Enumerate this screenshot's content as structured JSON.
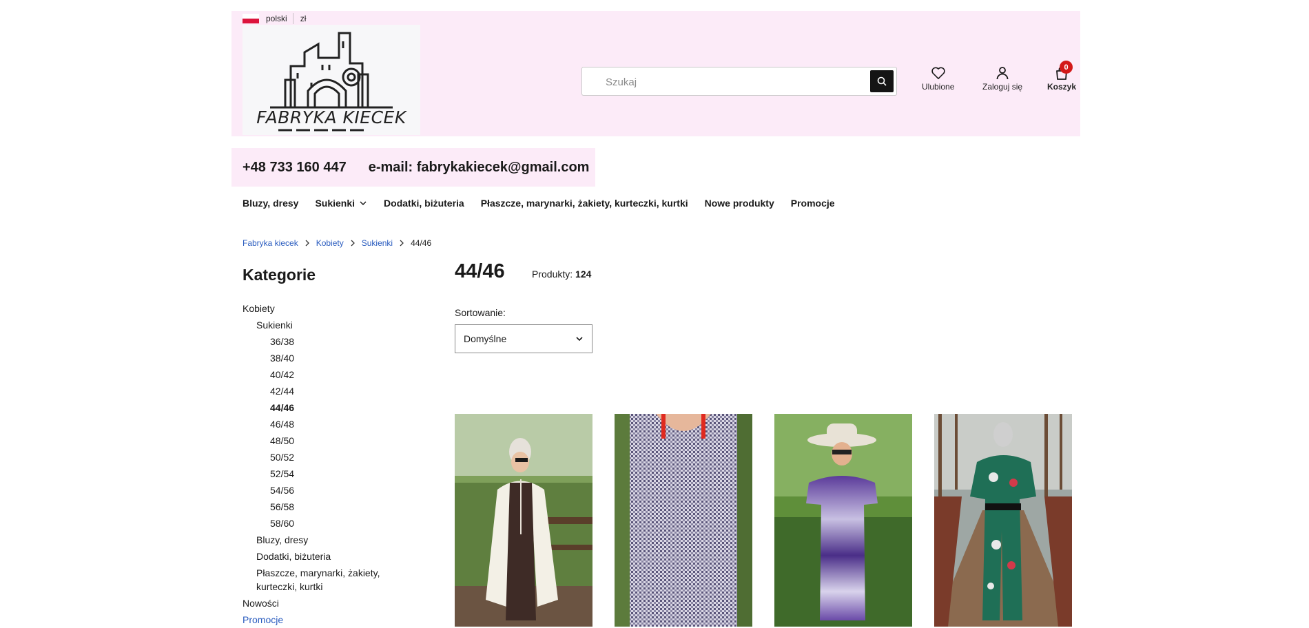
{
  "header": {
    "language": "polski",
    "currency": "zł",
    "logo_text": "FABRYKA KIECEK",
    "search": {
      "placeholder": "Szukaj"
    },
    "favorites_label": "Ulubione",
    "login_label": "Zaloguj się",
    "cart_label": "Koszyk",
    "cart_count": "0"
  },
  "contact": {
    "phone": "+48 733 160 447",
    "email": "e-mail: fabrykakiecek@gmail.com"
  },
  "nav": {
    "items": [
      {
        "label": "Bluzy, dresy"
      },
      {
        "label": "Sukienki"
      },
      {
        "label": "Dodatki, biżuteria"
      },
      {
        "label": "Płaszcze, marynarki, żakiety, kurteczki, kurtki"
      },
      {
        "label": "Nowe produkty"
      },
      {
        "label": "Promocje"
      }
    ]
  },
  "breadcrumb": [
    "Fabryka kiecek",
    "Kobiety",
    "Sukienki",
    "44/46"
  ],
  "sidebar": {
    "title": "Kategorie",
    "items": [
      "Kobiety",
      "Sukienki",
      "36/38",
      "38/40",
      "40/42",
      "42/44",
      "44/46",
      "46/48",
      "48/50",
      "50/52",
      "52/54",
      "54/56",
      "56/58",
      "58/60",
      "Bluzy, dresy",
      "Dodatki, biżuteria",
      "Płaszcze, marynarki, żakiety, kurteczki, kurtki",
      "Nowości",
      "Promocje"
    ]
  },
  "main": {
    "title": "44/46",
    "products_label": "Produkty:",
    "products_count": "124",
    "sort_label": "Sortowanie:",
    "sort_value": "Domyślne"
  },
  "colors": {
    "header_bg": "#fcebf8",
    "link": "#2a5cbf",
    "badge": "#d31818"
  }
}
